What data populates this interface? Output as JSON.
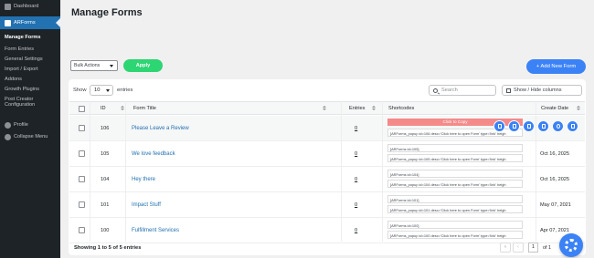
{
  "sidebar": {
    "items": [
      {
        "label": "Dashboard",
        "icon": "dashboard-icon"
      },
      {
        "label": "ARForms",
        "icon": "arforms-icon"
      }
    ],
    "submenu": [
      {
        "label": "Manage Forms",
        "current": true
      },
      {
        "label": "Form Entries"
      },
      {
        "label": "General Settings"
      },
      {
        "label": "Import / Export"
      },
      {
        "label": "Addons"
      },
      {
        "label": "Growth Plugins"
      },
      {
        "label": "Post Creator Configuration"
      }
    ],
    "profile": {
      "label": "Profile",
      "icon": "user-icon"
    },
    "collapse": {
      "label": "Collapse Menu",
      "icon": "collapse-icon"
    }
  },
  "page": {
    "title": "Manage Forms"
  },
  "toolbar": {
    "bulk_actions": "Bulk Actions",
    "apply": "Apply",
    "add_new": "+ Add New Form"
  },
  "table_controls": {
    "show_label": "Show",
    "page_size": "10",
    "entries_label": "entries",
    "search_placeholder": "Search",
    "show_hide": "Show / Hide columns"
  },
  "table": {
    "headers": {
      "id": "ID",
      "title": "Form Title",
      "entries": "Entries",
      "shortcodes": "Shortcodes",
      "date": "Create Date"
    },
    "copy_hint": "Click to Copy",
    "rows": [
      {
        "id": "106",
        "title": "Please Leave a Review",
        "entries": "0",
        "shortcode1": "[ARForms id=106]",
        "shortcode2": "[ARForms_popup id=106 desc='Click here to open Form' type='link' heigh",
        "date": "",
        "highlight": true
      },
      {
        "id": "105",
        "title": "We love feedback",
        "entries": "0",
        "shortcode1": "[ARForms id=105]",
        "shortcode2": "[ARForms_popup id=105 desc='Click here to open Form' type='link' heigh",
        "date": "Oct 16, 2025"
      },
      {
        "id": "104",
        "title": "Hey there",
        "entries": "0",
        "shortcode1": "[ARForms id=104]",
        "shortcode2": "[ARForms_popup id=104 desc='Click here to open Form' type='link' heigh",
        "date": "Oct 16, 2025"
      },
      {
        "id": "101",
        "title": "Impact Stuff",
        "entries": "0",
        "shortcode1": "[ARForms id=101]",
        "shortcode2": "[ARForms_popup id=101 desc='Click here to open Form' type='link' heigh",
        "date": "May 07, 2021"
      },
      {
        "id": "100",
        "title": "Fulfillment Services",
        "entries": "0",
        "shortcode1": "[ARForms id=100]",
        "shortcode2": "[ARForms_popup id=100 desc='Click here to open Form' type='link' heigh",
        "date": "Apr 07, 2021"
      }
    ]
  },
  "footer": {
    "showing": "Showing 1 to 5 of 5 entries",
    "current_page": "1",
    "of_pages": "of 1"
  },
  "colors": {
    "accent": "#3b82f6",
    "apply": "#2ed573",
    "sidebar": "#1d2327",
    "copy_bar": "#f48a8a"
  }
}
